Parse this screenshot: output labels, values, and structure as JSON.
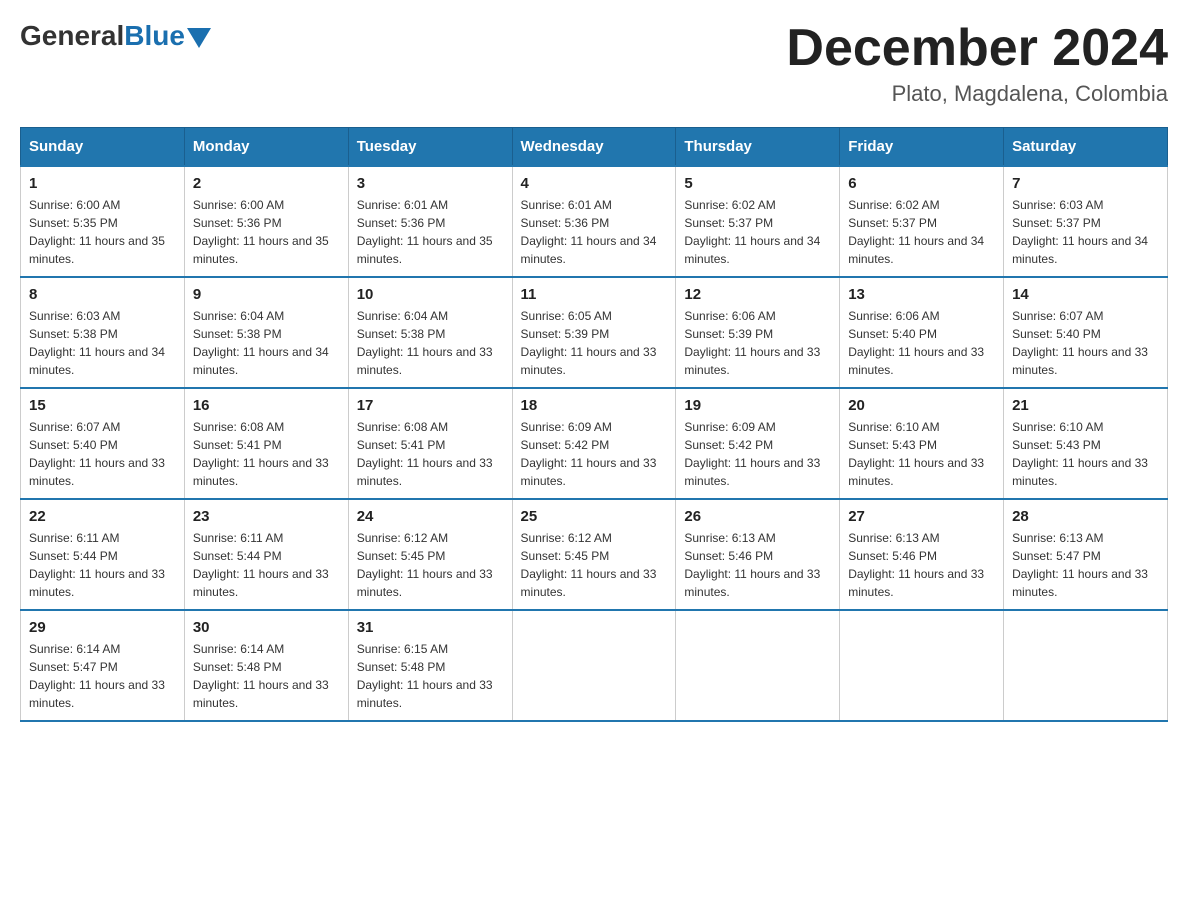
{
  "header": {
    "logo_general": "General",
    "logo_blue": "Blue",
    "month_title": "December 2024",
    "location": "Plato, Magdalena, Colombia"
  },
  "calendar": {
    "days_of_week": [
      "Sunday",
      "Monday",
      "Tuesday",
      "Wednesday",
      "Thursday",
      "Friday",
      "Saturday"
    ],
    "weeks": [
      [
        {
          "day": "1",
          "sunrise": "6:00 AM",
          "sunset": "5:35 PM",
          "daylight": "11 hours and 35 minutes."
        },
        {
          "day": "2",
          "sunrise": "6:00 AM",
          "sunset": "5:36 PM",
          "daylight": "11 hours and 35 minutes."
        },
        {
          "day": "3",
          "sunrise": "6:01 AM",
          "sunset": "5:36 PM",
          "daylight": "11 hours and 35 minutes."
        },
        {
          "day": "4",
          "sunrise": "6:01 AM",
          "sunset": "5:36 PM",
          "daylight": "11 hours and 34 minutes."
        },
        {
          "day": "5",
          "sunrise": "6:02 AM",
          "sunset": "5:37 PM",
          "daylight": "11 hours and 34 minutes."
        },
        {
          "day": "6",
          "sunrise": "6:02 AM",
          "sunset": "5:37 PM",
          "daylight": "11 hours and 34 minutes."
        },
        {
          "day": "7",
          "sunrise": "6:03 AM",
          "sunset": "5:37 PM",
          "daylight": "11 hours and 34 minutes."
        }
      ],
      [
        {
          "day": "8",
          "sunrise": "6:03 AM",
          "sunset": "5:38 PM",
          "daylight": "11 hours and 34 minutes."
        },
        {
          "day": "9",
          "sunrise": "6:04 AM",
          "sunset": "5:38 PM",
          "daylight": "11 hours and 34 minutes."
        },
        {
          "day": "10",
          "sunrise": "6:04 AM",
          "sunset": "5:38 PM",
          "daylight": "11 hours and 33 minutes."
        },
        {
          "day": "11",
          "sunrise": "6:05 AM",
          "sunset": "5:39 PM",
          "daylight": "11 hours and 33 minutes."
        },
        {
          "day": "12",
          "sunrise": "6:06 AM",
          "sunset": "5:39 PM",
          "daylight": "11 hours and 33 minutes."
        },
        {
          "day": "13",
          "sunrise": "6:06 AM",
          "sunset": "5:40 PM",
          "daylight": "11 hours and 33 minutes."
        },
        {
          "day": "14",
          "sunrise": "6:07 AM",
          "sunset": "5:40 PM",
          "daylight": "11 hours and 33 minutes."
        }
      ],
      [
        {
          "day": "15",
          "sunrise": "6:07 AM",
          "sunset": "5:40 PM",
          "daylight": "11 hours and 33 minutes."
        },
        {
          "day": "16",
          "sunrise": "6:08 AM",
          "sunset": "5:41 PM",
          "daylight": "11 hours and 33 minutes."
        },
        {
          "day": "17",
          "sunrise": "6:08 AM",
          "sunset": "5:41 PM",
          "daylight": "11 hours and 33 minutes."
        },
        {
          "day": "18",
          "sunrise": "6:09 AM",
          "sunset": "5:42 PM",
          "daylight": "11 hours and 33 minutes."
        },
        {
          "day": "19",
          "sunrise": "6:09 AM",
          "sunset": "5:42 PM",
          "daylight": "11 hours and 33 minutes."
        },
        {
          "day": "20",
          "sunrise": "6:10 AM",
          "sunset": "5:43 PM",
          "daylight": "11 hours and 33 minutes."
        },
        {
          "day": "21",
          "sunrise": "6:10 AM",
          "sunset": "5:43 PM",
          "daylight": "11 hours and 33 minutes."
        }
      ],
      [
        {
          "day": "22",
          "sunrise": "6:11 AM",
          "sunset": "5:44 PM",
          "daylight": "11 hours and 33 minutes."
        },
        {
          "day": "23",
          "sunrise": "6:11 AM",
          "sunset": "5:44 PM",
          "daylight": "11 hours and 33 minutes."
        },
        {
          "day": "24",
          "sunrise": "6:12 AM",
          "sunset": "5:45 PM",
          "daylight": "11 hours and 33 minutes."
        },
        {
          "day": "25",
          "sunrise": "6:12 AM",
          "sunset": "5:45 PM",
          "daylight": "11 hours and 33 minutes."
        },
        {
          "day": "26",
          "sunrise": "6:13 AM",
          "sunset": "5:46 PM",
          "daylight": "11 hours and 33 minutes."
        },
        {
          "day": "27",
          "sunrise": "6:13 AM",
          "sunset": "5:46 PM",
          "daylight": "11 hours and 33 minutes."
        },
        {
          "day": "28",
          "sunrise": "6:13 AM",
          "sunset": "5:47 PM",
          "daylight": "11 hours and 33 minutes."
        }
      ],
      [
        {
          "day": "29",
          "sunrise": "6:14 AM",
          "sunset": "5:47 PM",
          "daylight": "11 hours and 33 minutes."
        },
        {
          "day": "30",
          "sunrise": "6:14 AM",
          "sunset": "5:48 PM",
          "daylight": "11 hours and 33 minutes."
        },
        {
          "day": "31",
          "sunrise": "6:15 AM",
          "sunset": "5:48 PM",
          "daylight": "11 hours and 33 minutes."
        },
        null,
        null,
        null,
        null
      ]
    ]
  }
}
